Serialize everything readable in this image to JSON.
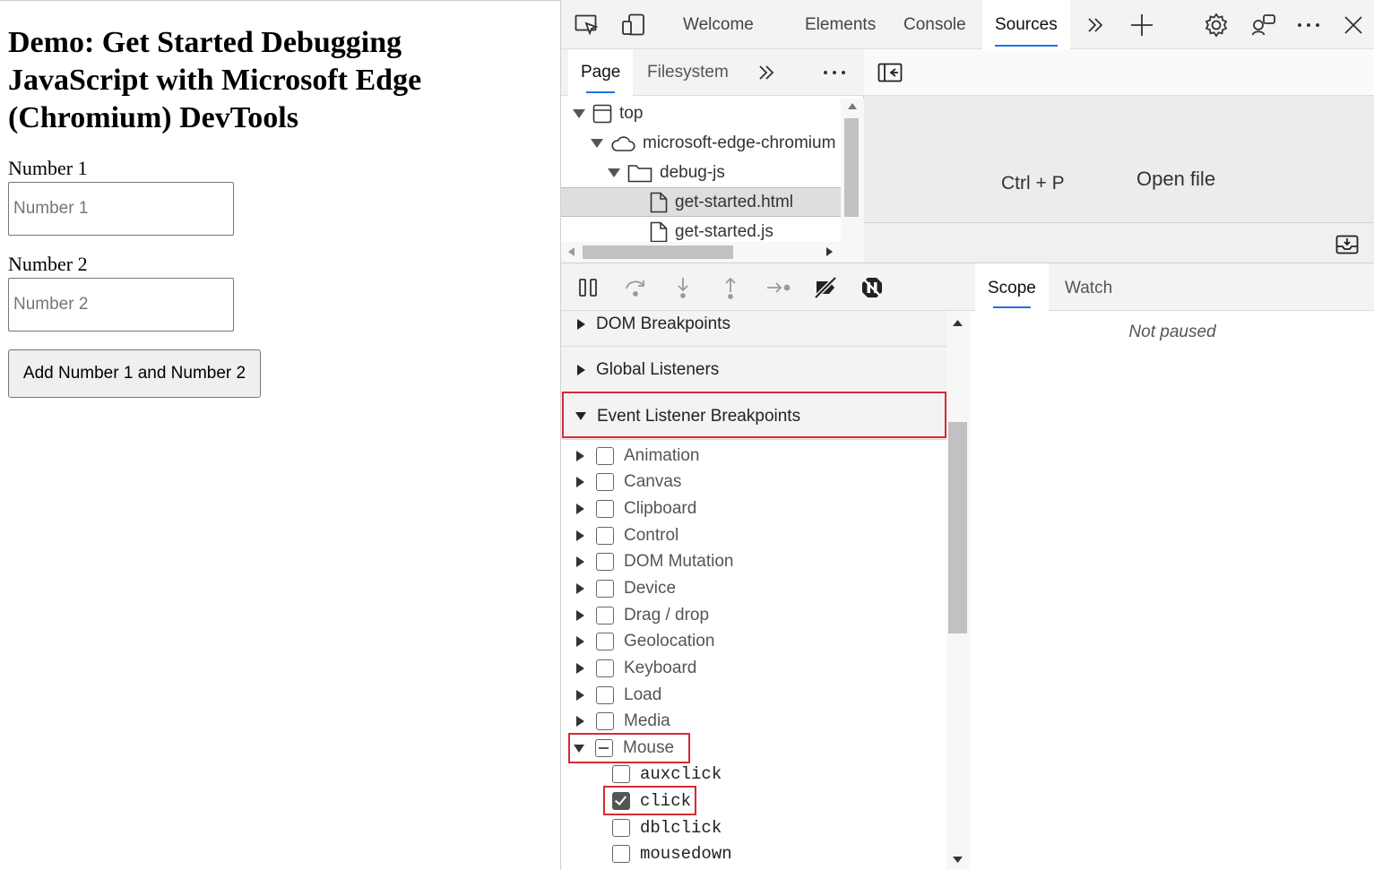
{
  "page": {
    "heading": "Demo: Get Started Debugging JavaScript with Microsoft Edge (Chromium) DevTools",
    "number1_label": "Number 1",
    "number1_placeholder": "Number 1",
    "number2_label": "Number 2",
    "number2_placeholder": "Number 2",
    "add_button": "Add Number 1 and Number 2"
  },
  "devtools": {
    "main_tabs": [
      "Welcome",
      "Elements",
      "Console",
      "Sources"
    ],
    "active_tab": "Sources",
    "navigator": {
      "tabs": [
        "Page",
        "Filesystem"
      ],
      "active_tab": "Page",
      "tree": [
        {
          "label": "top",
          "type": "frame"
        },
        {
          "label": "microsoft-edge-chromium",
          "type": "domain"
        },
        {
          "label": "debug-js",
          "type": "folder"
        },
        {
          "label": "get-started.html",
          "type": "file",
          "selected": true
        },
        {
          "label": "get-started.js",
          "type": "file"
        }
      ]
    },
    "editor": {
      "shortcut": "Ctrl + P",
      "shortcut_action": "Open file"
    },
    "breakpoints": {
      "sections": [
        "DOM Breakpoints",
        "Global Listeners",
        "Event Listener Breakpoints"
      ],
      "categories": [
        "Animation",
        "Canvas",
        "Clipboard",
        "Control",
        "DOM Mutation",
        "Device",
        "Drag / drop",
        "Geolocation",
        "Keyboard",
        "Load",
        "Media",
        "Mouse"
      ],
      "mouse_events": [
        "auxclick",
        "click",
        "dblclick",
        "mousedown"
      ],
      "checked_event": "click",
      "highlight_color": "#d52b35"
    },
    "scope": {
      "tabs": [
        "Scope",
        "Watch"
      ],
      "active_tab": "Scope",
      "status": "Not paused"
    },
    "accent_color": "#1a73e8"
  }
}
